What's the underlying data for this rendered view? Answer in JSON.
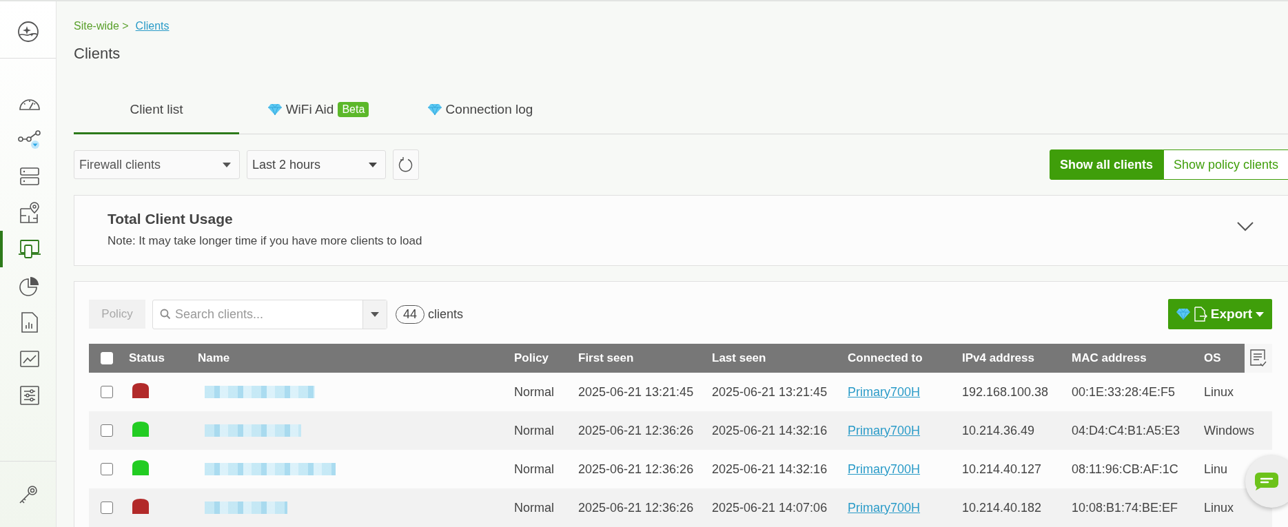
{
  "sidebar": {
    "items": [
      {
        "kind": "dashboard",
        "selected": false
      },
      {
        "kind": "topology",
        "selected": false
      },
      {
        "kind": "devices",
        "selected": false
      },
      {
        "kind": "floorplan",
        "selected": false
      },
      {
        "kind": "clients",
        "selected": true
      },
      {
        "kind": "applications",
        "selected": false
      },
      {
        "kind": "reports",
        "selected": false
      },
      {
        "kind": "monitor",
        "selected": false
      },
      {
        "kind": "settings",
        "selected": false
      }
    ]
  },
  "breadcrumb": {
    "parent": "Site-wide >",
    "current": "Clients"
  },
  "page_title": "Clients",
  "tabs": [
    {
      "label": "Client list",
      "selected": true,
      "premium": false
    },
    {
      "label": "WiFi Aid",
      "selected": false,
      "premium": true,
      "badge": "Beta"
    },
    {
      "label": "Connection log",
      "selected": false,
      "premium": true
    }
  ],
  "filters": {
    "client_type": "Firewall clients",
    "time_range": "Last 2 hours"
  },
  "view_buttons": [
    {
      "label": "Show all clients",
      "selected": true
    },
    {
      "label": "Show policy clients",
      "selected": false
    }
  ],
  "usage_panel": {
    "title": "Total Client Usage",
    "note": "Note: It may take longer time if you have more clients to load",
    "expanded": false
  },
  "toolbar": {
    "policy_button": {
      "label": "Policy",
      "disabled": true
    },
    "search": {
      "placeholder": "Search clients..."
    },
    "count": "44",
    "count_label": "clients",
    "export_button": "Export"
  },
  "table": {
    "select_all_checked": false,
    "columns": [
      "Status",
      "Name",
      "Policy",
      "First seen",
      "Last seen",
      "Connected to",
      "IPv4 address",
      "MAC address",
      "OS"
    ],
    "rows": [
      {
        "checked": false,
        "color": "#b22a2a",
        "policy": "Normal",
        "first_seen": "2025-06-21 13:21:45",
        "last_seen": "2025-06-21 13:21:45",
        "connected_to": "Primary700H",
        "ipv4": "192.168.100.38",
        "mac": "00:1E:33:28:4E:F5",
        "os": "Linux"
      },
      {
        "checked": false,
        "color": "#22cc22",
        "policy": "Normal",
        "first_seen": "2025-06-21 12:36:26",
        "last_seen": "2025-06-21 14:32:16",
        "connected_to": "Primary700H",
        "ipv4": "10.214.36.49",
        "mac": "04:D4:C4:B1:A5:E3",
        "os": "Windows"
      },
      {
        "checked": false,
        "color": "#22cc22",
        "policy": "Normal",
        "first_seen": "2025-06-21 12:36:26",
        "last_seen": "2025-06-21 14:32:16",
        "connected_to": "Primary700H",
        "ipv4": "10.214.40.127",
        "mac": "08:11:96:CB:AF:1C",
        "os": "Linu"
      },
      {
        "checked": false,
        "color": "#b22a2a",
        "policy": "Normal",
        "first_seen": "2025-06-21 12:36:26",
        "last_seen": "2025-06-21 14:07:06",
        "connected_to": "Primary700H",
        "ipv4": "10.214.40.182",
        "mac": "10:08:B1:74:BE:EF",
        "os": "Linux"
      }
    ]
  }
}
